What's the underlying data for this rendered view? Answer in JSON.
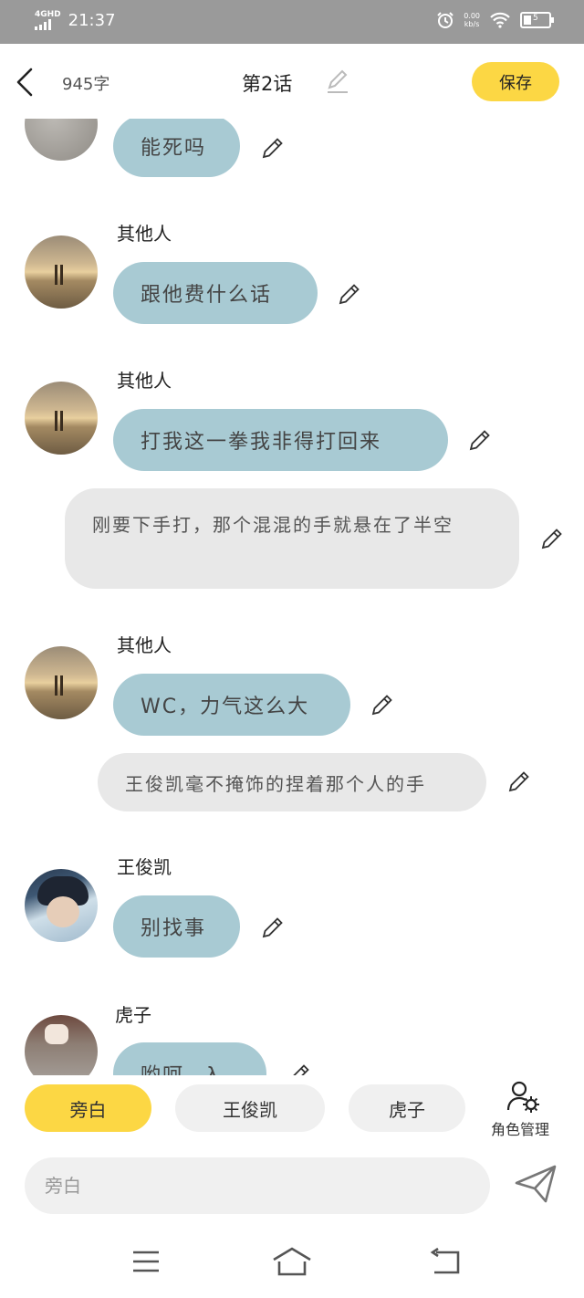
{
  "status_bar": {
    "network": "4GHD",
    "time": "21:37",
    "speed_value": "0.00",
    "speed_unit": "kb/s",
    "battery": "5"
  },
  "header": {
    "word_count": "945字",
    "title": "第2话",
    "save_label": "保存"
  },
  "messages": [
    {
      "type": "dialogue",
      "speaker": "",
      "text": "能死吗",
      "avatar": "gray-photo"
    },
    {
      "type": "dialogue",
      "speaker": "其他人",
      "text": "跟他费什么话",
      "avatar": "sunset-couple"
    },
    {
      "type": "dialogue",
      "speaker": "其他人",
      "text": "打我这一拳我非得打回来",
      "avatar": "sunset-couple"
    },
    {
      "type": "narration",
      "text": "刚要下手打，那个混混的手就悬在了半空"
    },
    {
      "type": "dialogue",
      "speaker": "其他人",
      "text": "WC，力气这么大",
      "avatar": "sunset-couple"
    },
    {
      "type": "narration",
      "text": "王俊凯毫不掩饰的捏着那个人的手"
    },
    {
      "type": "dialogue",
      "speaker": "王俊凯",
      "text": "别找事",
      "avatar": "boy-photo"
    },
    {
      "type": "dialogue",
      "speaker": "虎子",
      "text": "哟呵，λ",
      "avatar": "hand-photo"
    }
  ],
  "characters": [
    {
      "label": "旁白",
      "active": true
    },
    {
      "label": "王俊凯",
      "active": false
    },
    {
      "label": "虎子",
      "active": false
    }
  ],
  "role_manage_label": "角色管理",
  "input": {
    "placeholder": "旁白",
    "value": ""
  },
  "colors": {
    "accent": "#fcd744",
    "bubble": "#a8cad3",
    "narration": "#e8e8e8",
    "status_bar": "#9a9a9a"
  },
  "icons": {
    "back": "chevron-left-icon",
    "edit": "pencil-icon",
    "send": "paper-plane-icon",
    "roles": "user-gear-icon",
    "nav_menu": "menu-icon",
    "nav_home": "home-icon",
    "nav_back": "return-icon"
  }
}
